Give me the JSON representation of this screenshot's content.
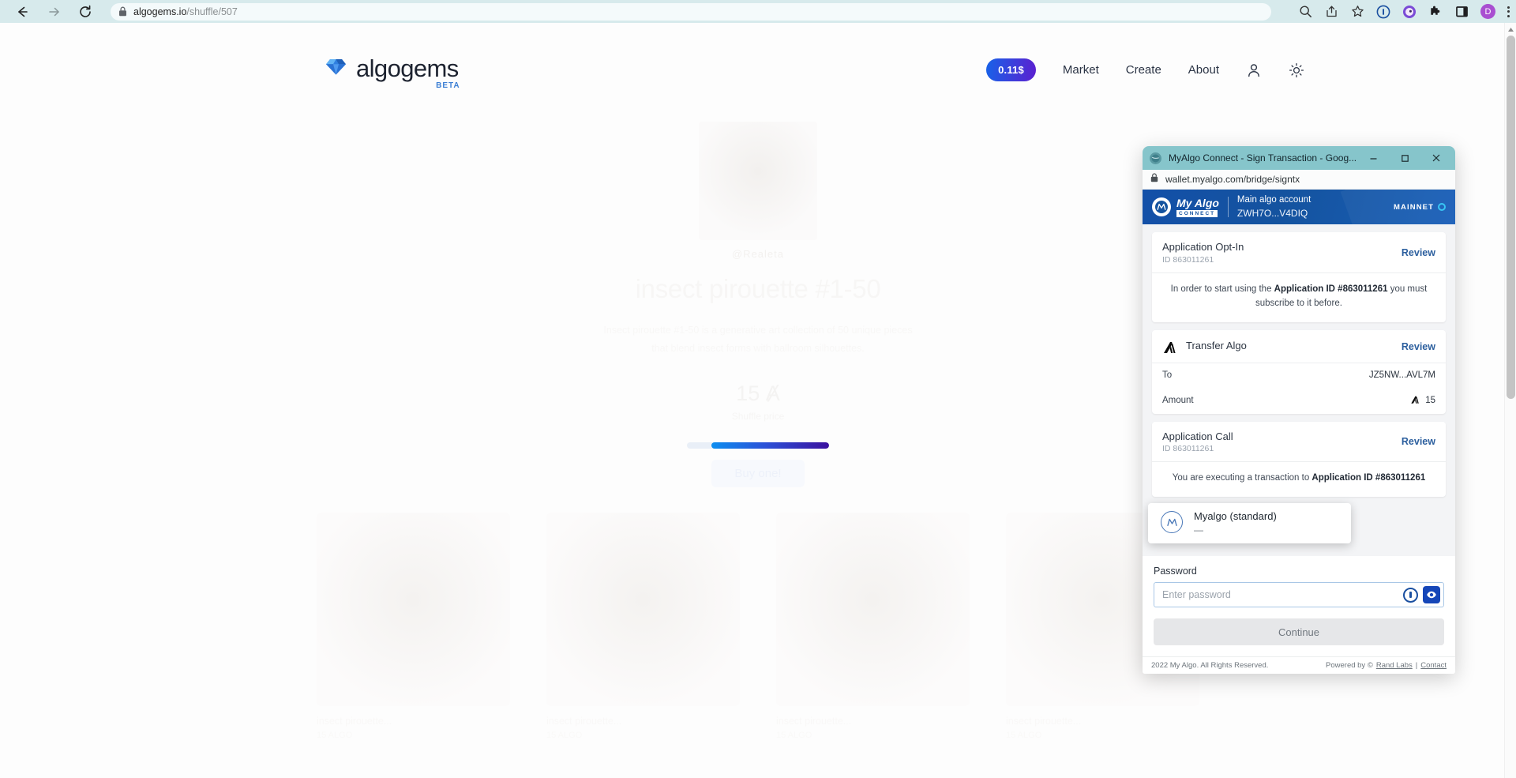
{
  "browser": {
    "back_icon": "back-arrow-icon",
    "forward_icon": "forward-arrow-icon",
    "reload_icon": "reload-icon",
    "lock_icon": "lock-icon",
    "url_domain": "algogems.io",
    "url_path": "/shuffle/507",
    "url_full": "algogems.io/shuffle/507",
    "toolbar_icons": [
      "search-icon",
      "share-icon",
      "bookmark-star-icon",
      "onepassword-icon",
      "extension-purple-icon",
      "puzzle-extensions-icon",
      "sidebar-panel-icon"
    ],
    "profile_initial": "D",
    "menu_icon": "kebab-menu-icon"
  },
  "site": {
    "brand_name": "algogems",
    "brand_badge": "BETA",
    "gem_icon": "gem-diamond-icon",
    "nav": {
      "price_pill": "0.11$",
      "links": [
        "Market",
        "Create",
        "About"
      ],
      "account_icon": "person-icon",
      "theme_icon": "sun-theme-icon"
    },
    "hero": {
      "collection_label": "@Realeta",
      "title": "insect pirouette #1-50",
      "description_line1": "Insect pirouette #1-50 is a generative art collection of 50 unique pieces",
      "description_line2": "that blend insect forms with ballroom silhouettes.",
      "price": "15",
      "price_currency_icon": "algorand-icon",
      "price_sub": "Shuffle price",
      "progress_percent": 83,
      "buy_button": "Buy one!"
    },
    "cards": [
      {
        "title": "insect pirouette...",
        "sub": "15 ALGO"
      },
      {
        "title": "insect pirouette...",
        "sub": "15 ALGO"
      },
      {
        "title": "insect pirouette...",
        "sub": "15 ALGO"
      },
      {
        "title": "insect pirouette...",
        "sub": "15 ALGO"
      }
    ]
  },
  "popup": {
    "window_title": "MyAlgo Connect - Sign Transaction - Goog...",
    "favicon": "myalgo-favicon",
    "minimize_icon": "minimize-icon",
    "maximize_icon": "maximize-icon",
    "close_icon": "close-icon",
    "url_lock_icon": "lock-icon",
    "url": "wallet.myalgo.com/bridge/signtx",
    "header": {
      "logo_name": "My Algo",
      "logo_connect": "CONNECT",
      "account_name": "Main algo account",
      "account_address": "ZWH7O...V4DIQ",
      "network": "MAINNET"
    },
    "transactions": [
      {
        "title": "Application Opt-In",
        "id": "ID 863011261",
        "review": "Review",
        "note_prefix": "In order to start using the ",
        "note_bold": "Application ID #863011261",
        "note_suffix": " you must subscribe to it before.",
        "icon": null
      },
      {
        "title": "Transfer Algo",
        "id": null,
        "review": "Review",
        "icon": "algorand-icon",
        "rows": [
          {
            "label": "To",
            "value": "JZ5NW...AVL7M",
            "icon": null
          },
          {
            "label": "Amount",
            "value": "15",
            "icon": "algorand-icon"
          }
        ]
      },
      {
        "title": "Application Call",
        "id": "ID 863011261",
        "review": "Review",
        "note_prefix": "You are executing a transaction to ",
        "note_bold": "Application ID #863011261",
        "note_suffix": "",
        "icon": null
      }
    ],
    "form": {
      "password_label": "Password",
      "password_placeholder": "Enter password",
      "password_value": "",
      "onepassword_icon": "onepassword-icon",
      "eye_icon": "eye-show-password-icon",
      "continue_button": "Continue"
    },
    "autofill": {
      "icon": "myalgo-circle-icon",
      "title": "Myalgo (standard)",
      "subtitle": "—"
    },
    "footer": {
      "copyright": "2022 My Algo. All Rights Reserved.",
      "powered_by": "Powered by ©",
      "rand_labs": "Rand Labs",
      "separator": "|",
      "contact": "Contact"
    }
  },
  "colors": {
    "browser_chrome": "#d7eaec",
    "popup_titlebar": "#86c5cb",
    "myalgo_blue": "#14539f",
    "mainnet_cyan": "#38c6f4",
    "review_link": "#2c5f9e",
    "eye_button": "#1546b8",
    "brand_beta": "#3c7fd4"
  }
}
